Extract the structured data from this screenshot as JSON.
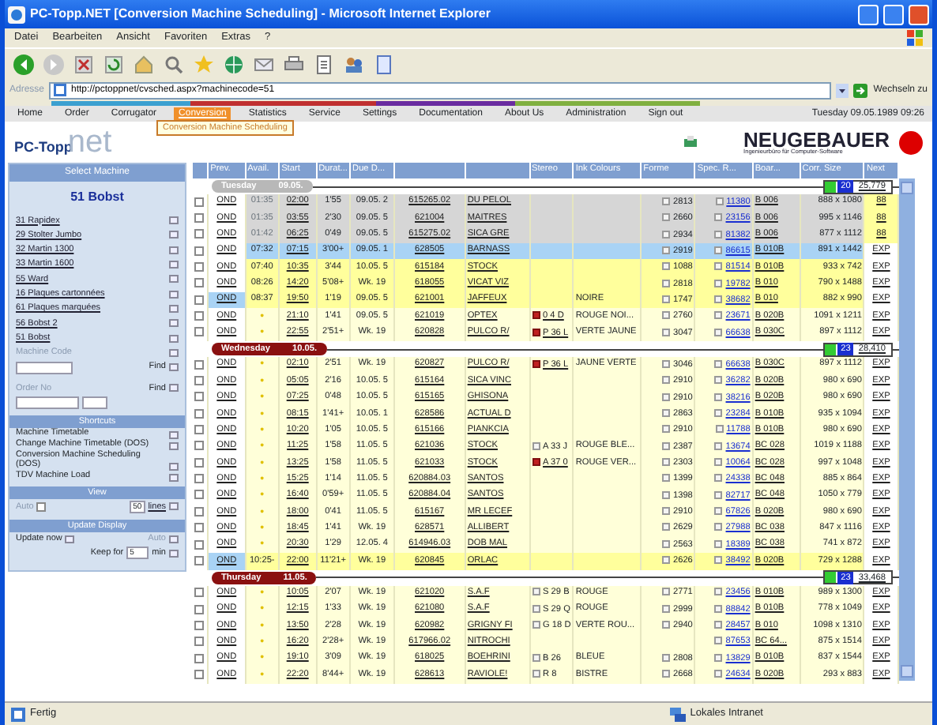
{
  "window": {
    "title": "PC-Topp.NET [Conversion Machine Scheduling] - Microsoft Internet Explorer",
    "menu": [
      "Datei",
      "Bearbeiten",
      "Ansicht",
      "Favoriten",
      "Extras",
      "?"
    ],
    "address_label": "Adresse",
    "url": "http://pctoppnet/cvsched.aspx?machinecode=51",
    "go_label": "Wechseln zu"
  },
  "nav": {
    "items": [
      {
        "label": "Home",
        "selected": false
      },
      {
        "label": "Order",
        "selected": false
      },
      {
        "label": "Corrugator",
        "selected": false
      },
      {
        "label": "Conversion",
        "selected": true
      },
      {
        "label": "Statistics",
        "selected": false
      },
      {
        "label": "Service",
        "selected": false
      },
      {
        "label": "Settings",
        "selected": false
      },
      {
        "label": "Documentation",
        "selected": false
      },
      {
        "label": "About Us",
        "selected": false
      },
      {
        "label": "Administration",
        "selected": false
      },
      {
        "label": "Sign out",
        "selected": false
      }
    ],
    "datetime": "Tuesday 09.05.1989 09:26",
    "tooltip": "Conversion Machine Scheduling"
  },
  "logo": {
    "main": "PC-Topp",
    "suffix": "net"
  },
  "vendor": {
    "name": "NEUGEBAUER",
    "tagline": "Ingenieurbüro für Computer-Software"
  },
  "sidebar": {
    "title": "Select Machine",
    "current": "51 Bobst",
    "machines": [
      "31 Rapidex",
      "29 Stolter Jumbo",
      "32 Martin 1300",
      "33 Martin 1600",
      "55 Ward",
      "16 Plaques cartonnées",
      "61 Plaques marquées",
      "56 Bobst 2",
      "51 Bobst"
    ],
    "machine_code_label": "Machine Code",
    "find_label": "Find",
    "order_label": "Order No",
    "order_find_label": "Find",
    "shortcuts_title": "Shortcuts",
    "shortcuts": [
      "Machine Timetable",
      "Change Machine Timetable (DOS)",
      "Conversion Machine Scheduling (DOS)",
      "TDV Machine Load"
    ],
    "view_title": "View",
    "auto_label": "Auto",
    "auto_checked": false,
    "lines_value": "50",
    "lines_label": "lines",
    "update_title": "Update Display",
    "update_now": "Update now",
    "update_auto": "Auto",
    "keep_label": "Keep for",
    "keep_value": "5",
    "keep_unit": "min"
  },
  "table": {
    "columns": [
      "Prev.",
      "Avail.",
      "Start",
      "Durat...",
      "Due D...",
      null,
      null,
      "Stereo",
      "Ink Colours",
      "Forme",
      "Spec. R...",
      "Boar...",
      "Corr. Size",
      "Next"
    ],
    "days": [
      {
        "name": "Tuesday",
        "date": "09.05.",
        "past": true,
        "count": "20",
        "total": "25,779",
        "rows": [
          {
            "checked": false,
            "prev": "OND",
            "prev_highlight": false,
            "avail": "01:35",
            "start": "02:00",
            "duration": "1'55",
            "due": "09.05. 2",
            "order": "615265.02",
            "customer": "DU PELOL",
            "forme": "2813",
            "spec": "11380",
            "board": "B 006",
            "size": "888 x 1080",
            "next": "88",
            "next_highlight": true,
            "color": "#d6d6d6"
          },
          {
            "checked": false,
            "prev": "OND",
            "prev_highlight": false,
            "avail": "01:35",
            "start": "03:55",
            "duration": "2'30",
            "due": "09.05. 5",
            "order": "621004",
            "customer": "MAITRES",
            "forme": "2660",
            "spec": "23156",
            "board": "B 006",
            "size": "995 x 1146",
            "next": "88",
            "next_highlight": true,
            "color": "#d6d6d6"
          },
          {
            "checked": false,
            "prev": "OND",
            "prev_highlight": false,
            "avail": "01:42",
            "start": "06:25",
            "duration": "0'49",
            "due": "09.05. 5",
            "order": "615275.02",
            "customer": "SICA GRE",
            "forme": "2934",
            "spec": "81382",
            "board": "B 006",
            "size": "877 x 1112",
            "next": "88",
            "next_highlight": true,
            "color": "#d6d6d6"
          },
          {
            "checked": false,
            "prev": "OND",
            "prev_highlight": false,
            "avail": "07:32",
            "start": "07:15",
            "duration": "3'00+",
            "due": "09.05. 1",
            "order": "628505",
            "customer": "BARNASS",
            "forme": "2919",
            "spec": "86615",
            "board": "B 010B",
            "size": "891 x 1442",
            "next": "EXP",
            "next_highlight": false,
            "color": "#a9d3f5"
          },
          {
            "checked": false,
            "prev": "OND",
            "prev_highlight": false,
            "avail": "07:40",
            "start": "10:35",
            "duration": "3'44",
            "due": "10.05. 5",
            "order": "615184",
            "customer": "STOCK",
            "forme": "1088",
            "spec": "81514",
            "board": "B 010B",
            "size": "933 x 742",
            "next": "EXP",
            "next_highlight": false,
            "color": "#ffff9c"
          },
          {
            "checked": false,
            "prev": "OND",
            "prev_highlight": false,
            "avail": "08:26",
            "start": "14:20",
            "duration": "5'08+",
            "due": "Wk. 19",
            "order": "618055",
            "customer": "VICAT VIZ",
            "forme": "2818",
            "spec": "19782",
            "board": "B 010",
            "size": "790 x 1488",
            "next": "EXP",
            "next_highlight": false,
            "color": "#ffff9c"
          },
          {
            "checked": false,
            "prev": "OND",
            "prev_highlight": true,
            "avail": "08:37",
            "start": "19:50",
            "duration": "1'19",
            "due": "09.05. 5",
            "order": "621001",
            "customer": "JAFFEUX",
            "ink": "NOIRE",
            "forme": "1747",
            "spec": "38682",
            "board": "B 010",
            "size": "882 x 990",
            "next": "EXP",
            "next_highlight": false,
            "color": "#ffff9c"
          },
          {
            "checked": false,
            "prev": "OND",
            "prev_highlight": false,
            "avail": "•",
            "start": "21:10",
            "duration": "1'41",
            "due": "09.05. 5",
            "order": "621019",
            "customer": "OPTEX",
            "stereo": {
              "text": "0 4 D",
              "marked": true
            },
            "ink": "ROUGE NOI...",
            "forme": "2760",
            "spec": "23671",
            "board": "B 020B",
            "size": "1091 x 1211",
            "next": "EXP",
            "next_highlight": false,
            "color": "#ffffd9"
          },
          {
            "checked": false,
            "prev": "OND",
            "prev_highlight": false,
            "avail": "•",
            "start": "22:55",
            "duration": "2'51+",
            "due": "Wk. 19",
            "order": "620828",
            "customer": "PULCO R/",
            "stereo": {
              "text": "P 36 L",
              "marked": true
            },
            "ink": "VERTE JAUNE",
            "forme": "3047",
            "spec": "66638",
            "board": "B 030C",
            "size": "897 x 1112",
            "next": "EXP",
            "next_highlight": false,
            "color": "#ffffd9"
          }
        ]
      },
      {
        "name": "Wednesday",
        "date": "10.05.",
        "past": false,
        "count": "23",
        "total": "28,410",
        "rows": [
          {
            "checked": false,
            "prev": "OND",
            "prev_highlight": false,
            "avail": "•",
            "start": "02:10",
            "duration": "2'51",
            "due": "Wk. 19",
            "order": "620827",
            "customer": "PULCO R/",
            "stereo": {
              "text": "P 36 L",
              "marked": true
            },
            "ink": "JAUNE VERTE",
            "forme": "3046",
            "spec": "66638",
            "board": "B 030C",
            "size": "897 x 1112",
            "next": "EXP",
            "next_highlight": false,
            "color": "#ffffd9"
          },
          {
            "checked": false,
            "prev": "OND",
            "prev_highlight": false,
            "avail": "•",
            "start": "05:05",
            "duration": "2'16",
            "due": "10.05. 5",
            "order": "615164",
            "customer": "SICA VINC",
            "forme": "2910",
            "spec": "36282",
            "board": "B 020B",
            "size": "980 x 690",
            "next": "EXP",
            "next_highlight": false,
            "color": "#ffffd9"
          },
          {
            "checked": false,
            "prev": "OND",
            "prev_highlight": false,
            "avail": "•",
            "start": "07:25",
            "duration": "0'48",
            "due": "10.05. 5",
            "order": "615165",
            "customer": "GHISONA",
            "forme": "2910",
            "spec": "38216",
            "board": "B 020B",
            "size": "980 x 690",
            "next": "EXP",
            "next_highlight": false,
            "color": "#ffffd9"
          },
          {
            "checked": false,
            "prev": "OND",
            "prev_highlight": false,
            "avail": "•",
            "start": "08:15",
            "duration": "1'41+",
            "due": "10.05. 1",
            "order": "628586",
            "customer": "ACTUAL D",
            "forme": "2863",
            "spec": "23284",
            "board": "B 010B",
            "size": "935 x 1094",
            "next": "EXP",
            "next_highlight": false,
            "color": "#ffffd9"
          },
          {
            "checked": false,
            "prev": "OND",
            "prev_highlight": false,
            "avail": "•",
            "start": "10:20",
            "duration": "1'05",
            "due": "10.05. 5",
            "order": "615166",
            "customer": "PIANKCIA",
            "forme": "2910",
            "spec": "11788",
            "board": "B 010B",
            "size": "980 x 690",
            "next": "EXP",
            "next_highlight": false,
            "color": "#ffffd9"
          },
          {
            "checked": false,
            "prev": "OND",
            "prev_highlight": false,
            "avail": "•",
            "start": "11:25",
            "duration": "1'58",
            "due": "11.05. 5",
            "order": "621036",
            "customer": "STOCK",
            "stereo": {
              "text": "A 33 J",
              "marked": false
            },
            "ink": "ROUGE BLE...",
            "forme": "2387",
            "spec": "13674",
            "board": "BC 028",
            "size": "1019 x 1188",
            "next": "EXP",
            "next_highlight": false,
            "color": "#ffffd9"
          },
          {
            "checked": false,
            "prev": "OND",
            "prev_highlight": false,
            "avail": "•",
            "start": "13:25",
            "duration": "1'58",
            "due": "11.05. 5",
            "order": "621033",
            "customer": "STOCK",
            "stereo": {
              "text": "A 37 0",
              "marked": true
            },
            "ink": "ROUGE VER...",
            "forme": "2303",
            "spec": "10064",
            "board": "BC 028",
            "size": "997 x 1048",
            "next": "EXP",
            "next_highlight": false,
            "color": "#ffffd9"
          },
          {
            "checked": false,
            "prev": "OND",
            "prev_highlight": false,
            "avail": "•",
            "start": "15:25",
            "duration": "1'14",
            "due": "11.05. 5",
            "order": "620884.03",
            "customer": "SANTOS",
            "forme": "1399",
            "spec": "24338",
            "board": "BC 048",
            "size": "885 x 864",
            "next": "EXP",
            "next_highlight": false,
            "color": "#ffffd9"
          },
          {
            "checked": false,
            "prev": "OND",
            "prev_highlight": false,
            "avail": "•",
            "start": "16:40",
            "duration": "0'59+",
            "due": "11.05. 5",
            "order": "620884.04",
            "customer": "SANTOS",
            "forme": "1398",
            "spec": "82717",
            "board": "BC 048",
            "size": "1050 x 779",
            "next": "EXP",
            "next_highlight": false,
            "color": "#ffffd9"
          },
          {
            "checked": false,
            "prev": "OND",
            "prev_highlight": false,
            "avail": "•",
            "start": "18:00",
            "duration": "0'41",
            "due": "11.05. 5",
            "order": "615167",
            "customer": "MR LECEF",
            "forme": "2910",
            "spec": "67826",
            "board": "B 020B",
            "size": "980 x 690",
            "next": "EXP",
            "next_highlight": false,
            "color": "#ffffd9"
          },
          {
            "checked": false,
            "prev": "OND",
            "prev_highlight": false,
            "avail": "•",
            "start": "18:45",
            "duration": "1'41",
            "due": "Wk. 19",
            "order": "628571",
            "customer": "ALLIBERT",
            "forme": "2629",
            "spec": "27988",
            "board": "BC 038",
            "size": "847 x 1116",
            "next": "EXP",
            "next_highlight": false,
            "color": "#ffffd9"
          },
          {
            "checked": false,
            "prev": "OND",
            "prev_highlight": false,
            "avail": "•",
            "start": "20:30",
            "duration": "1'29",
            "due": "12.05. 4",
            "order": "614946.03",
            "customer": "DOB MAL",
            "forme": "2563",
            "spec": "18389",
            "board": "BC 038",
            "size": "741 x 872",
            "next": "EXP",
            "next_highlight": false,
            "color": "#ffffd9"
          },
          {
            "checked": false,
            "prev": "OND",
            "prev_highlight": true,
            "avail": "10:25-",
            "start": "22:00",
            "duration": "11'21+",
            "due": "Wk. 19",
            "order": "620845",
            "customer": "ORLAC",
            "forme": "2626",
            "spec": "38492",
            "board": "B 020B",
            "size": "729 x 1288",
            "next": "EXP",
            "next_highlight": false,
            "color": "#ffff9c"
          }
        ]
      },
      {
        "name": "Thursday",
        "date": "11.05.",
        "past": false,
        "count": "23",
        "total": "33,468",
        "rows": [
          {
            "checked": false,
            "prev": "OND",
            "prev_highlight": false,
            "avail": "•",
            "start": "10:05",
            "duration": "2'07",
            "due": "Wk. 19",
            "order": "621020",
            "customer": "S.A.F",
            "stereo": {
              "text": "S 29 B",
              "marked": false
            },
            "ink": "ROUGE",
            "forme": "2771",
            "spec": "23456",
            "board": "B 010B",
            "size": "989 x 1300",
            "next": "EXP",
            "next_highlight": false,
            "color": "#ffffd9"
          },
          {
            "checked": false,
            "prev": "OND",
            "prev_highlight": false,
            "avail": "•",
            "start": "12:15",
            "duration": "1'33",
            "due": "Wk. 19",
            "order": "621080",
            "customer": "S.A.F",
            "stereo": {
              "text": "S 29 Q",
              "marked": false
            },
            "ink": "ROUGE",
            "forme": "2999",
            "spec": "88842",
            "board": "B 010B",
            "size": "778 x 1049",
            "next": "EXP",
            "next_highlight": false,
            "color": "#ffffd9"
          },
          {
            "checked": false,
            "prev": "OND",
            "prev_highlight": false,
            "avail": "•",
            "start": "13:50",
            "duration": "2'28",
            "due": "Wk. 19",
            "order": "620982",
            "customer": "GRIGNY FI",
            "stereo": {
              "text": "G 18 D",
              "marked": false
            },
            "ink": "VERTE ROU...",
            "forme": "2940",
            "spec": "28457",
            "board": "B 010",
            "size": "1098 x 1310",
            "next": "EXP",
            "next_highlight": false,
            "color": "#ffffd9"
          },
          {
            "checked": false,
            "prev": "OND",
            "prev_highlight": false,
            "avail": "•",
            "start": "16:20",
            "duration": "2'28+",
            "due": "Wk. 19",
            "order": "617966.02",
            "customer": "NITROCHI",
            "spec": "87653",
            "board": "BC 64...",
            "size": "875 x 1514",
            "next": "EXP",
            "next_highlight": false,
            "color": "#ffffd9"
          },
          {
            "checked": false,
            "prev": "OND",
            "prev_highlight": false,
            "avail": "•",
            "start": "19:10",
            "duration": "3'09",
            "due": "Wk. 19",
            "order": "618025",
            "customer": "BOEHRINI",
            "stereo": {
              "text": "B 26",
              "marked": false
            },
            "ink": "BLEUE",
            "forme": "2808",
            "spec": "13829",
            "board": "B 010B",
            "size": "837 x 1544",
            "next": "EXP",
            "next_highlight": false,
            "color": "#ffffd9"
          },
          {
            "checked": false,
            "prev": "OND",
            "prev_highlight": false,
            "avail": "•",
            "start": "22:20",
            "duration": "8'44+",
            "due": "Wk. 19",
            "order": "628613",
            "customer": "RAVIOLE!",
            "stereo": {
              "text": "R 8",
              "marked": false
            },
            "ink": "BISTRE",
            "forme": "2668",
            "spec": "24634",
            "board": "B 020B",
            "size": "293 x 883",
            "next": "EXP",
            "next_highlight": false,
            "color": "#ffffd9"
          }
        ]
      }
    ]
  },
  "status_bar": {
    "left": "Fertig",
    "right": "Lokales Intranet"
  }
}
